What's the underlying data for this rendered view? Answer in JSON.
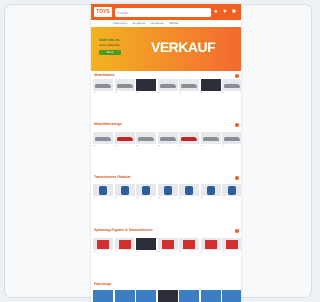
{
  "header": {
    "logo": "TOYS",
    "search_placeholder": "Suche...",
    "nav": [
      "Kategorien",
      "Angebote",
      "Neuheiten",
      "Marken"
    ]
  },
  "banner": {
    "title": "VERKAUF",
    "subtitle": "Sale bis zu",
    "subtitle2": "Jetzt entdecken",
    "button": "Shop"
  },
  "sections": [
    {
      "title": "Modellautos"
    },
    {
      "title": "Modellfahrzeuge"
    },
    {
      "title": "Transformers Roboter"
    },
    {
      "title": "Spielzeug-Figuren & Sammelboxen"
    },
    {
      "title": "Fahrzeuge"
    }
  ],
  "colors": {
    "accent": "#f0611f"
  }
}
